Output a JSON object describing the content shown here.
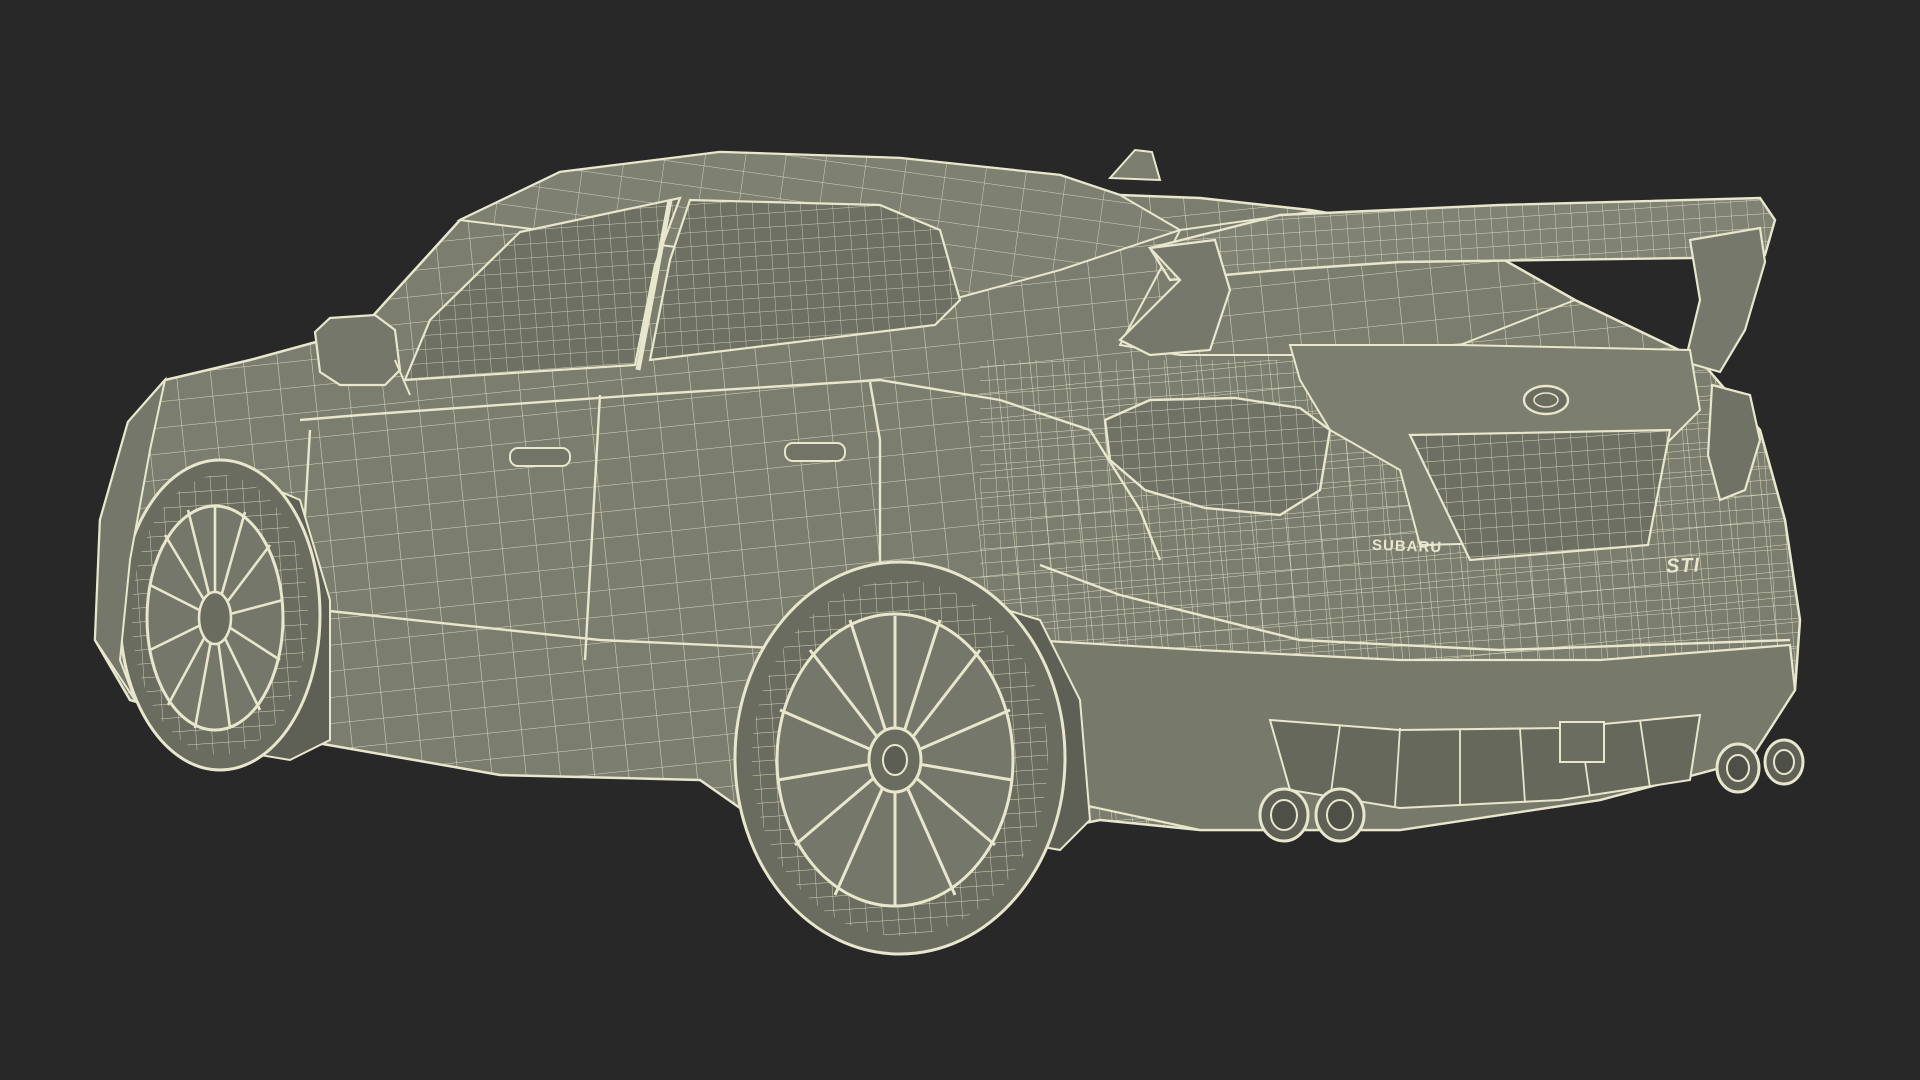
{
  "scene": {
    "background_color": "#282828",
    "body_fill_color": "#7b7d6e",
    "wire_color": "#e8e6cc",
    "dark_fill_color": "#686a5d"
  },
  "badges": {
    "rear_left": "SUBARU",
    "rear_right": "STI"
  }
}
